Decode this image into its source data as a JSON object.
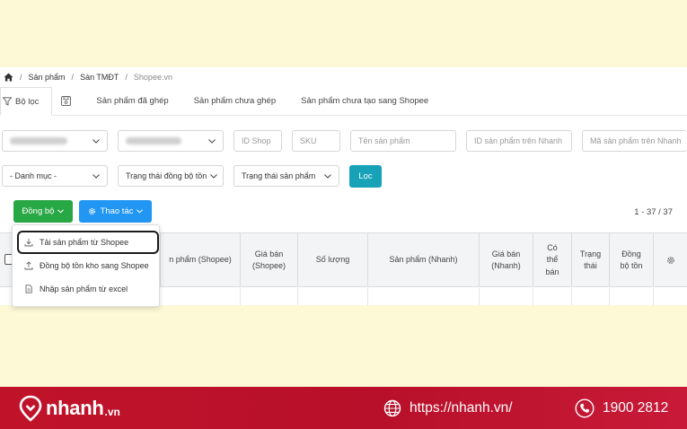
{
  "breadcrumb": {
    "items": [
      "Sản phẩm",
      "Sàn TMĐT"
    ],
    "current": "Shopee.vn",
    "separator": "/"
  },
  "tabs": [
    {
      "label": "Bộ lọc",
      "icon": "filter-icon",
      "active": true
    },
    {
      "label": "",
      "icon": "save-icon",
      "active": false
    },
    {
      "label": "Sản phẩm đã ghép",
      "active": false
    },
    {
      "label": "Sản phẩm chưa ghép",
      "active": false
    },
    {
      "label": "Sản phẩm chưa tạo sang Shopee",
      "active": false
    }
  ],
  "filters": {
    "shop_id_placeholder": "ID Shop",
    "sku_placeholder": "SKU",
    "product_name_placeholder": "Tên sản phẩm",
    "nhanh_product_id_placeholder": "ID sản phẩm trên Nhanh",
    "nhanh_product_code_placeholder": "Mã sản phẩm trên Nhanh",
    "category_select": "- Danh mục -",
    "sync_status_select": "Trạng thái đồng bộ tồn",
    "product_status_select": "Trạng thái sản phẩm",
    "filter_button": "Lọc"
  },
  "actions": {
    "sync_button": "Đồng bộ",
    "operations_button": "Thao tác"
  },
  "pagination": {
    "range": "1 - 37 / 37"
  },
  "dropdown": {
    "items": [
      {
        "label": "Tải sản phẩm từ Shopee",
        "icon": "download-icon",
        "highlighted": true
      },
      {
        "label": "Đồng bộ tồn kho sang Shopee",
        "icon": "upload-icon",
        "highlighted": false
      },
      {
        "label": "Nhập sản phẩm từ excel",
        "icon": "file-icon",
        "highlighted": false
      }
    ]
  },
  "table": {
    "columns": [
      {
        "lines": [
          "n phẩm (Shopee)"
        ]
      },
      {
        "lines": [
          "Giá bán",
          "(Shopee)"
        ]
      },
      {
        "lines": [
          "Số lượng"
        ]
      },
      {
        "lines": [
          "Sản phẩm (Nhanh)"
        ]
      },
      {
        "lines": [
          "Giá bán",
          "(Nhanh)"
        ]
      },
      {
        "lines": [
          "Có",
          "thể",
          "bán"
        ]
      },
      {
        "lines": [
          "Trạng",
          "thái"
        ]
      },
      {
        "lines": [
          "Đồng",
          "bộ tồn"
        ]
      }
    ]
  },
  "footer": {
    "brand": "nhanh",
    "brand_suffix": ".vn",
    "website": "https://nhanh.vn/",
    "phone": "1900 2812"
  },
  "colors": {
    "background": "#fdf8d6",
    "footer": "#be122a",
    "green": "#28a745",
    "blue": "#2196f3",
    "teal": "#17a2b8"
  }
}
